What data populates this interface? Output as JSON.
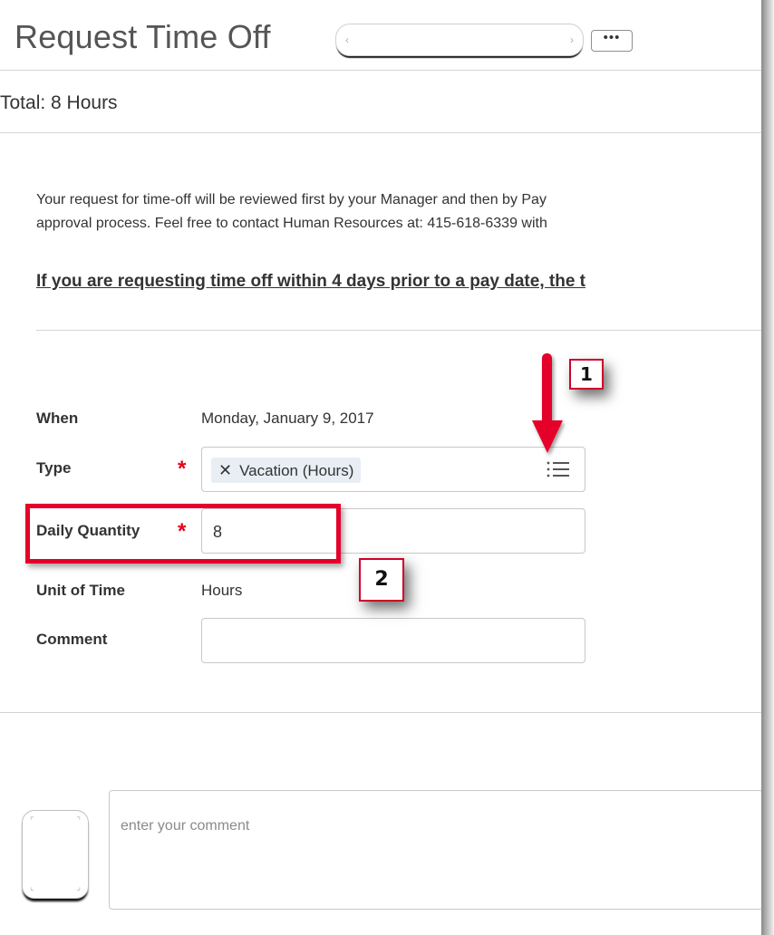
{
  "header": {
    "title": "Request Time Off",
    "more_label": "•••"
  },
  "summary": {
    "total": "Total: 8 Hours"
  },
  "instructions": {
    "line1": "Your request for time-off will be reviewed first by your Manager and then by Pay",
    "line2": "approval process. Feel free to contact Human Resources at: 415-618-6339 with",
    "notice": "If you are requesting time off within 4 days prior to a pay date, the t"
  },
  "form": {
    "when_label": "When",
    "when_value": "Monday, January 9, 2017",
    "type_label": "Type",
    "type_chip": "Vacation (Hours)",
    "type_chip_remove": "✕",
    "daily_quantity_label": "Daily Quantity",
    "daily_quantity_value": "8",
    "unit_label": "Unit of Time",
    "unit_value": "Hours",
    "comment_label": "Comment",
    "required_marker": "*",
    "type_icon": "list-prompt-icon"
  },
  "callouts": {
    "badge1": "1",
    "badge2": "2",
    "highlight_color": "#e5002a"
  },
  "comments": {
    "placeholder": "enter your comment"
  }
}
